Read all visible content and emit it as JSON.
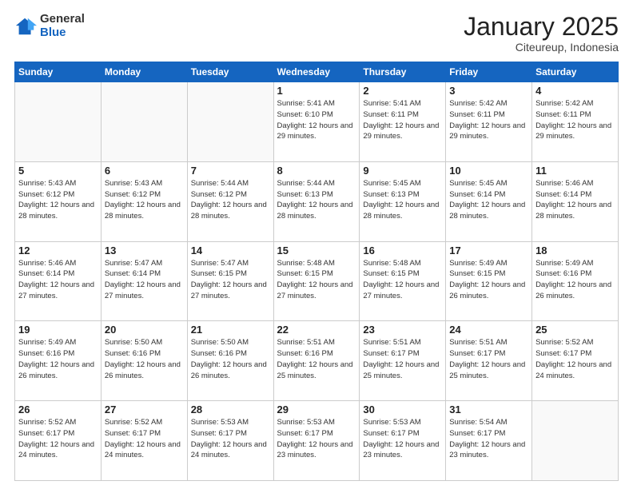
{
  "logo": {
    "general": "General",
    "blue": "Blue"
  },
  "header": {
    "month_year": "January 2025",
    "location": "Citeureup, Indonesia"
  },
  "days_of_week": [
    "Sunday",
    "Monday",
    "Tuesday",
    "Wednesday",
    "Thursday",
    "Friday",
    "Saturday"
  ],
  "weeks": [
    [
      {
        "day": "",
        "info": ""
      },
      {
        "day": "",
        "info": ""
      },
      {
        "day": "",
        "info": ""
      },
      {
        "day": "1",
        "info": "Sunrise: 5:41 AM\nSunset: 6:10 PM\nDaylight: 12 hours\nand 29 minutes."
      },
      {
        "day": "2",
        "info": "Sunrise: 5:41 AM\nSunset: 6:11 PM\nDaylight: 12 hours\nand 29 minutes."
      },
      {
        "day": "3",
        "info": "Sunrise: 5:42 AM\nSunset: 6:11 PM\nDaylight: 12 hours\nand 29 minutes."
      },
      {
        "day": "4",
        "info": "Sunrise: 5:42 AM\nSunset: 6:11 PM\nDaylight: 12 hours\nand 29 minutes."
      }
    ],
    [
      {
        "day": "5",
        "info": "Sunrise: 5:43 AM\nSunset: 6:12 PM\nDaylight: 12 hours\nand 28 minutes."
      },
      {
        "day": "6",
        "info": "Sunrise: 5:43 AM\nSunset: 6:12 PM\nDaylight: 12 hours\nand 28 minutes."
      },
      {
        "day": "7",
        "info": "Sunrise: 5:44 AM\nSunset: 6:12 PM\nDaylight: 12 hours\nand 28 minutes."
      },
      {
        "day": "8",
        "info": "Sunrise: 5:44 AM\nSunset: 6:13 PM\nDaylight: 12 hours\nand 28 minutes."
      },
      {
        "day": "9",
        "info": "Sunrise: 5:45 AM\nSunset: 6:13 PM\nDaylight: 12 hours\nand 28 minutes."
      },
      {
        "day": "10",
        "info": "Sunrise: 5:45 AM\nSunset: 6:14 PM\nDaylight: 12 hours\nand 28 minutes."
      },
      {
        "day": "11",
        "info": "Sunrise: 5:46 AM\nSunset: 6:14 PM\nDaylight: 12 hours\nand 28 minutes."
      }
    ],
    [
      {
        "day": "12",
        "info": "Sunrise: 5:46 AM\nSunset: 6:14 PM\nDaylight: 12 hours\nand 27 minutes."
      },
      {
        "day": "13",
        "info": "Sunrise: 5:47 AM\nSunset: 6:14 PM\nDaylight: 12 hours\nand 27 minutes."
      },
      {
        "day": "14",
        "info": "Sunrise: 5:47 AM\nSunset: 6:15 PM\nDaylight: 12 hours\nand 27 minutes."
      },
      {
        "day": "15",
        "info": "Sunrise: 5:48 AM\nSunset: 6:15 PM\nDaylight: 12 hours\nand 27 minutes."
      },
      {
        "day": "16",
        "info": "Sunrise: 5:48 AM\nSunset: 6:15 PM\nDaylight: 12 hours\nand 27 minutes."
      },
      {
        "day": "17",
        "info": "Sunrise: 5:49 AM\nSunset: 6:15 PM\nDaylight: 12 hours\nand 26 minutes."
      },
      {
        "day": "18",
        "info": "Sunrise: 5:49 AM\nSunset: 6:16 PM\nDaylight: 12 hours\nand 26 minutes."
      }
    ],
    [
      {
        "day": "19",
        "info": "Sunrise: 5:49 AM\nSunset: 6:16 PM\nDaylight: 12 hours\nand 26 minutes."
      },
      {
        "day": "20",
        "info": "Sunrise: 5:50 AM\nSunset: 6:16 PM\nDaylight: 12 hours\nand 26 minutes."
      },
      {
        "day": "21",
        "info": "Sunrise: 5:50 AM\nSunset: 6:16 PM\nDaylight: 12 hours\nand 26 minutes."
      },
      {
        "day": "22",
        "info": "Sunrise: 5:51 AM\nSunset: 6:16 PM\nDaylight: 12 hours\nand 25 minutes."
      },
      {
        "day": "23",
        "info": "Sunrise: 5:51 AM\nSunset: 6:17 PM\nDaylight: 12 hours\nand 25 minutes."
      },
      {
        "day": "24",
        "info": "Sunrise: 5:51 AM\nSunset: 6:17 PM\nDaylight: 12 hours\nand 25 minutes."
      },
      {
        "day": "25",
        "info": "Sunrise: 5:52 AM\nSunset: 6:17 PM\nDaylight: 12 hours\nand 24 minutes."
      }
    ],
    [
      {
        "day": "26",
        "info": "Sunrise: 5:52 AM\nSunset: 6:17 PM\nDaylight: 12 hours\nand 24 minutes."
      },
      {
        "day": "27",
        "info": "Sunrise: 5:52 AM\nSunset: 6:17 PM\nDaylight: 12 hours\nand 24 minutes."
      },
      {
        "day": "28",
        "info": "Sunrise: 5:53 AM\nSunset: 6:17 PM\nDaylight: 12 hours\nand 24 minutes."
      },
      {
        "day": "29",
        "info": "Sunrise: 5:53 AM\nSunset: 6:17 PM\nDaylight: 12 hours\nand 23 minutes."
      },
      {
        "day": "30",
        "info": "Sunrise: 5:53 AM\nSunset: 6:17 PM\nDaylight: 12 hours\nand 23 minutes."
      },
      {
        "day": "31",
        "info": "Sunrise: 5:54 AM\nSunset: 6:17 PM\nDaylight: 12 hours\nand 23 minutes."
      },
      {
        "day": "",
        "info": ""
      }
    ]
  ]
}
